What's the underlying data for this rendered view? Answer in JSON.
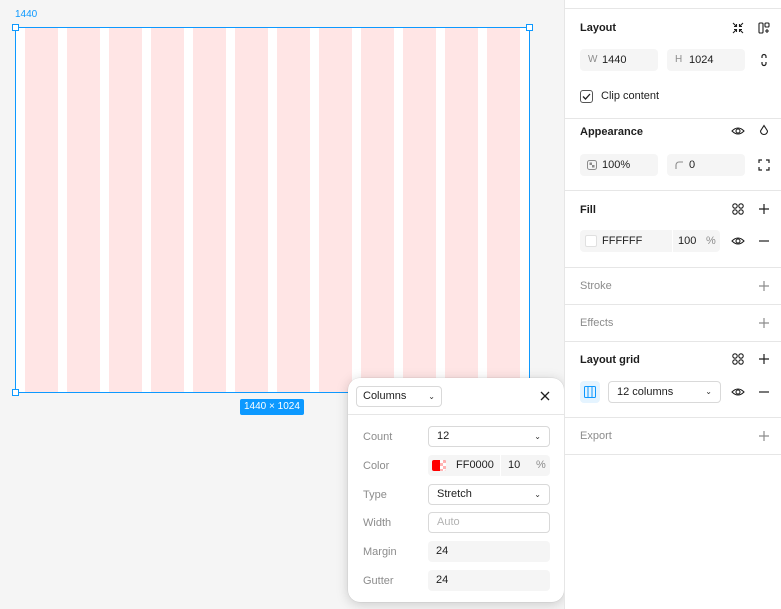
{
  "canvas": {
    "frame_label": "1440",
    "size_badge": "1440 × 1024",
    "column_count": 12,
    "column_color": "#ffe5e5",
    "selection_color": "#0d99ff"
  },
  "grid_popover": {
    "type_select": "Columns",
    "rows": {
      "count": {
        "label": "Count",
        "value": "12"
      },
      "color": {
        "label": "Color",
        "hex": "FF0000",
        "opacity": "10",
        "unit": "%"
      },
      "type": {
        "label": "Type",
        "value": "Stretch"
      },
      "width": {
        "label": "Width",
        "placeholder": "Auto"
      },
      "margin": {
        "label": "Margin",
        "value": "24"
      },
      "gutter": {
        "label": "Gutter",
        "value": "24"
      }
    }
  },
  "panel": {
    "layout": {
      "title": "Layout",
      "width_prefix": "W",
      "width": "1440",
      "height_prefix": "H",
      "height": "1024",
      "clip_content": "Clip content"
    },
    "appearance": {
      "title": "Appearance",
      "opacity": "100%",
      "radius": "0"
    },
    "fill": {
      "title": "Fill",
      "hex": "FFFFFF",
      "opacity": "100",
      "unit": "%"
    },
    "stroke": {
      "title": "Stroke"
    },
    "effects": {
      "title": "Effects"
    },
    "layout_grid": {
      "title": "Layout grid",
      "selection": "12 columns"
    },
    "export": {
      "title": "Export"
    }
  }
}
